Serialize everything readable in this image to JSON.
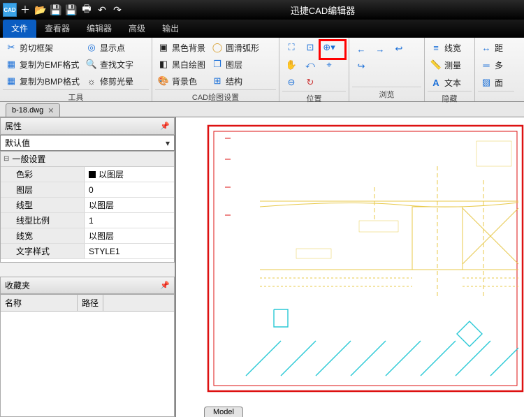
{
  "app": {
    "title": "迅捷CAD编辑器"
  },
  "tabs": {
    "file": "文件",
    "viewer": "查看器",
    "editor": "编辑器",
    "advanced": "高级",
    "output": "输出"
  },
  "ribbon": {
    "group_tools": "工具",
    "group_cad": "CAD绘图设置",
    "group_pos": "位置",
    "group_nav": "浏览",
    "group_hide": "隐藏",
    "btn_clipframe": "剪切框架",
    "btn_copy_emf": "复制为EMF格式",
    "btn_copy_bmp": "复制为BMP格式",
    "btn_showpts": "显示点",
    "btn_findtext": "查找文字",
    "btn_trimhalo": "修剪光晕",
    "btn_blackbg": "黑色背景",
    "btn_bwdraw": "黑白绘图",
    "btn_bgcolor": "背景色",
    "btn_arc": "圆滑弧形",
    "btn_layer": "图层",
    "btn_struct": "结构",
    "btn_linew": "线宽",
    "btn_measure": "测量",
    "btn_text": "文本",
    "btn_dist": "距",
    "btn_multi": "多",
    "btn_area": "面"
  },
  "doc": {
    "name": "b-18.dwg",
    "model_tab": "Model"
  },
  "props": {
    "panel_title": "属性",
    "default_val": "默认值",
    "section": "一般设置",
    "rows": {
      "color_k": "色彩",
      "color_v": "以图层",
      "layer_k": "图层",
      "layer_v": "0",
      "ltype_k": "线型",
      "ltype_v": "以图层",
      "lscale_k": "线型比例",
      "lscale_v": "1",
      "lweight_k": "线宽",
      "lweight_v": "以图层",
      "tstyle_k": "文字样式",
      "tstyle_v": "STYLE1"
    }
  },
  "fav": {
    "panel_title": "收藏夹",
    "col_name": "名称",
    "col_path": "路径"
  }
}
